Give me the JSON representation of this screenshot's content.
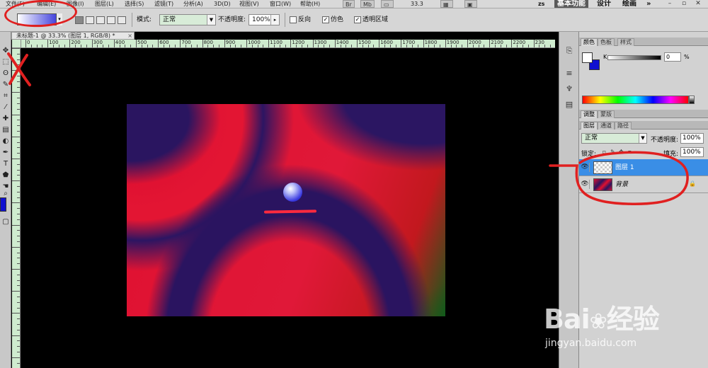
{
  "menu": {
    "items": [
      "文件(F)",
      "编辑(E)",
      "图像(I)",
      "图层(L)",
      "选择(S)",
      "滤镜(T)",
      "分析(A)",
      "3D(D)",
      "视图(V)",
      "窗口(W)",
      "帮助(H)"
    ],
    "bridge_btn": "Br",
    "minibridge_btn": "Mb",
    "zoom": "33.3",
    "workspace_prefix": "zs",
    "workspaces": [
      "基本功能",
      "设计",
      "绘画"
    ],
    "more": "»"
  },
  "options": {
    "mode_label": "模式:",
    "mode_value": "正常",
    "opacity_label": "不透明度:",
    "opacity_value": "100%",
    "reverse_label": "反向",
    "dither_label": "仿色",
    "transparency_label": "透明区域",
    "gradient_colors": {
      "start": "#ffffff",
      "end": "#2a2ad8"
    }
  },
  "document": {
    "tab_title": "未标题-1 @ 33.3% (图层 1, RGB/8) *",
    "ruler_h_labels": [
      "0",
      "100",
      "200",
      "300",
      "400",
      "500",
      "600",
      "700",
      "800",
      "900",
      "1000",
      "1100",
      "1200",
      "1300",
      "1400",
      "1500",
      "1600",
      "1700",
      "1800",
      "1900",
      "2000",
      "2100",
      "2200",
      "230"
    ]
  },
  "panels": {
    "color_tabs": [
      "颜色",
      "色板",
      "样式"
    ],
    "k_label": "K",
    "k_value": "0",
    "k_unit": "%",
    "adjust_tabs": [
      "调整",
      "蒙版"
    ],
    "layer_tabs": [
      "图层",
      "通道",
      "路径"
    ],
    "blend_mode": "正常",
    "opacity_label": "不透明度:",
    "opacity_value": "100%",
    "lock_label": "锁定:",
    "fill_label": "填充:",
    "fill_value": "100%",
    "layers": [
      {
        "name": "图层 1",
        "selected": true
      },
      {
        "name": "背景",
        "selected": false,
        "locked": true
      }
    ]
  },
  "colors": {
    "foreground": "#ffffff",
    "background": "#1010d0",
    "selection": "#3a8ee6",
    "annotation": "#e02020"
  },
  "watermark": {
    "logo_a": "Bai",
    "logo_b": "经验",
    "url": "jingyan.baidu.com"
  }
}
